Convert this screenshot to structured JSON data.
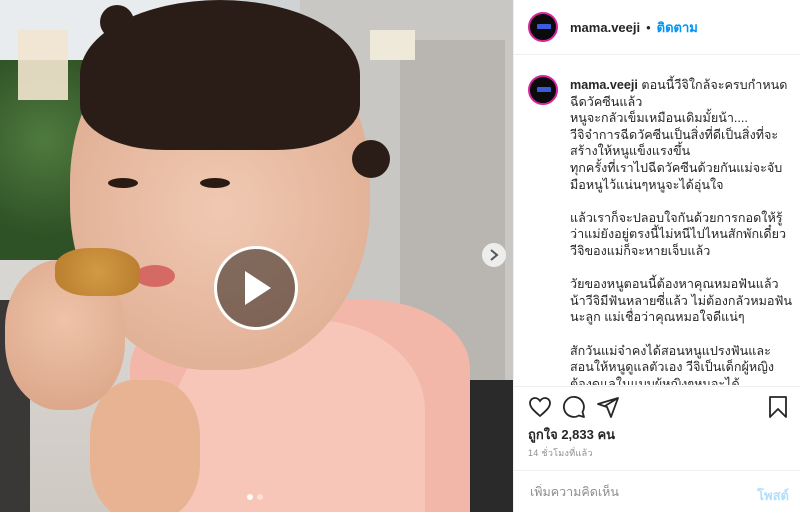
{
  "post": {
    "username": "mama.veeji",
    "separator": "•",
    "follow_label": "ติดตาม",
    "caption": "ตอนนี้วีจิใกล้จะครบกำหนดฉีดวัคซีนแล้ว\nหนูจะกลัวเข็มเหมือนเดิมมั้ยน้า....\nวีจิจ๋าการฉีดวัคซีนเป็นสิ่งที่ดีเป็นสิ่งที่จะสร้างให้หนูแข็งแรงขึ้น\nทุกครั้งที่เราไปฉีดวัคซีนด้วยกันแม่จะจับมือหนูไว้แน่นๆหนูจะได้อุ่นใจ\n\nแล้วเราก็จะปลอบใจกันด้วยการกอดให้รู้ว่าแม่ยังอยู่ตรงนี้ไม่หนีไปไหนสักพักเดี๋ยววีจิของแม่ก็จะหายเจ็บแล้ว\n\nวัยของหนูตอนนี้ต้องหาคุณหมอฟันแล้วน้าวีจิมีฟันหลายซี่แล้ว ไม่ต้องกลัวหมอฟันนะลูก แม่เชื่อว่าคุณหมอใจดีแน่ๆ\n\nสักวันแม่จ๋าคงได้สอนหนูแปรงฟันและสอนให้หนูดูแลตัวเอง วีจิเป็นเด็กผู้หญิงต้องดูแลในแบบผู้หญิงๆหนูจะได้พัฒนาการของสมองที่ดี",
    "likes": "ถูกใจ 2,833 คน",
    "time": "14 ชั่วโมงที่แล้ว",
    "comment_placeholder": "เพิ่มความคิดเห็น",
    "post_label": "โพสต์"
  },
  "media": {
    "type": "video",
    "slide_count": 2,
    "current_slide": 1
  },
  "icons": {
    "like": "heart-icon",
    "comment": "comment-icon",
    "share": "share-icon",
    "save": "bookmark-icon",
    "play": "play-icon",
    "next": "chevron-right-icon"
  },
  "colors": {
    "accent": "#0095f6",
    "post_disabled": "#b2dffc",
    "avatar_ring": "#d6249f"
  }
}
